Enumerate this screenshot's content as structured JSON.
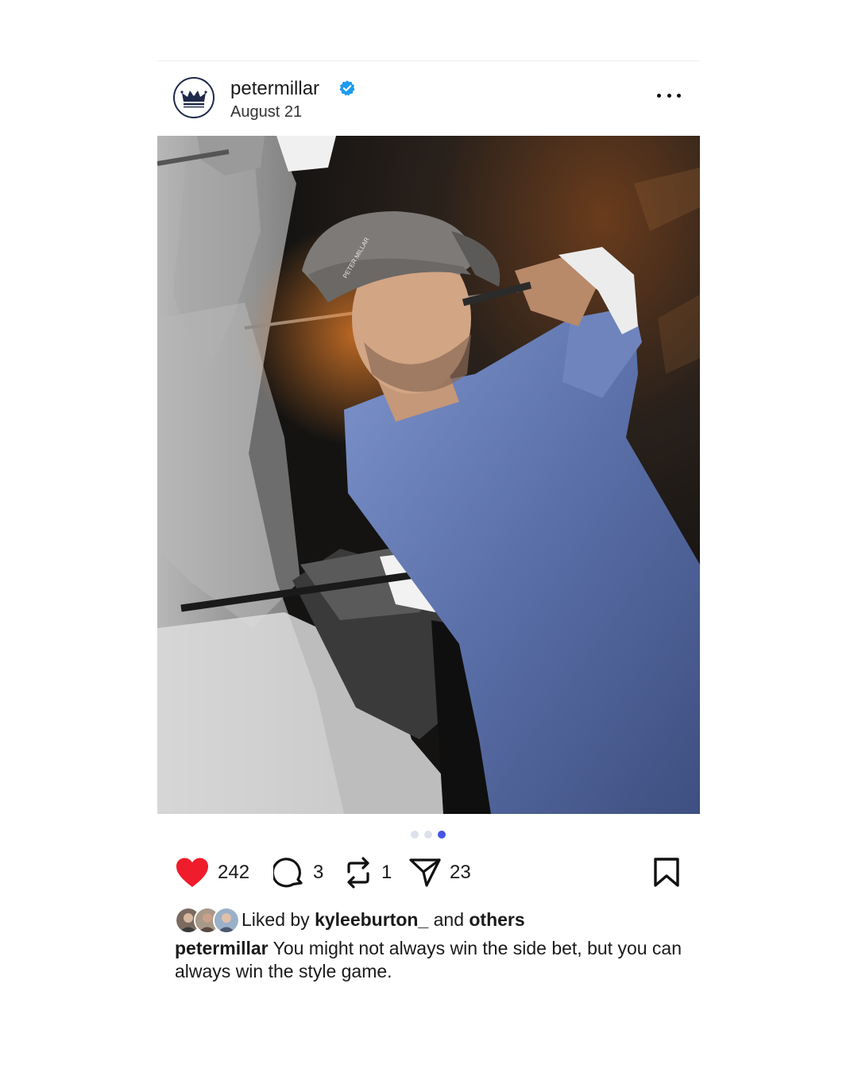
{
  "post": {
    "username": "petermillar",
    "date": "August 21",
    "image_alt": "Golfer in a grey cap and blue long-sleeve top mid-swing, with black-and-white motion echoes",
    "carousel": {
      "total": 3,
      "active": 3
    }
  },
  "actions": {
    "likes": "242",
    "comments": "3",
    "reposts": "1",
    "shares": "23"
  },
  "liked_by": {
    "prefix": "Liked by",
    "user": "kyleeburton_",
    "middle": "and",
    "suffix": "others"
  },
  "caption": {
    "username": "petermillar",
    "text": "You might not always win the side bet, but you can always win the style game."
  },
  "colors": {
    "heart": "#ef1c2b",
    "verified": "#1d9bf0",
    "carousel_active": "#4655e6",
    "carousel_inactive": "#dde1ec",
    "brand_navy": "#1f2a4a"
  },
  "icons": {
    "avatar": "crown-logo-icon",
    "verified": "verified-badge-icon",
    "more": "more-options-icon",
    "like": "heart-icon",
    "comment": "comment-bubble-icon",
    "repost": "repost-icon",
    "share": "paper-plane-icon",
    "save": "bookmark-icon"
  }
}
